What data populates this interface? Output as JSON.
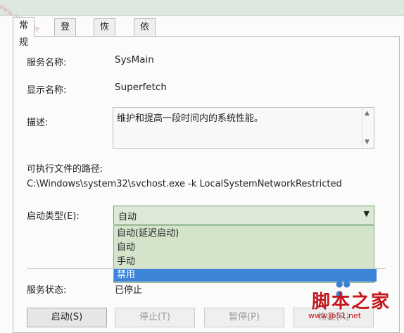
{
  "tabs": [
    {
      "label": "常规"
    },
    {
      "label": "登录"
    },
    {
      "label": "恢复"
    },
    {
      "label": "依存关系"
    }
  ],
  "fields": {
    "service_name_label": "服务名称:",
    "service_name_value": "SysMain",
    "display_name_label": "显示名称:",
    "display_name_value": "Superfetch",
    "description_label": "描述:",
    "description_value": "维护和提高一段时间内的系统性能。",
    "path_label": "可执行文件的路径:",
    "path_value": "C:\\Windows\\system32\\svchost.exe -k LocalSystemNetworkRestricted",
    "startup_type_label": "启动类型(E):",
    "startup_type_value": "自动",
    "service_status_label": "服务状态:",
    "service_status_value": "已停止"
  },
  "startup_options": [
    {
      "label": "自动(延迟启动)"
    },
    {
      "label": "自动"
    },
    {
      "label": "手动"
    },
    {
      "label": "禁用"
    }
  ],
  "buttons": {
    "start": "启动(S)",
    "stop": "停止(T)",
    "pause": "暂停(P)",
    "resume": "恢复(R)"
  },
  "watermark": {
    "diagonal": "www.jb51.net",
    "brand": "脚本之家",
    "url": "www.jb51.net"
  },
  "colors": {
    "selected_option": "#3b84d8",
    "dropdown_bg": "#d3e4cb",
    "brand_red": "#c4161c"
  }
}
